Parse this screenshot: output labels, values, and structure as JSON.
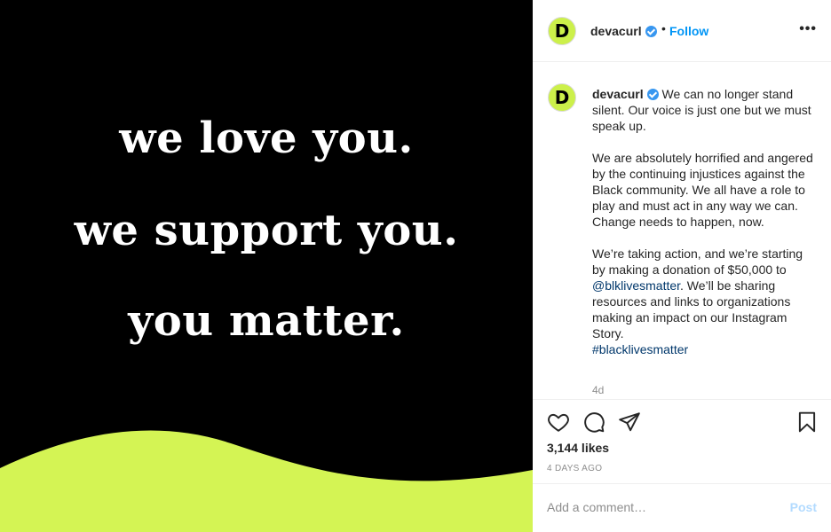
{
  "image": {
    "lines": [
      "we love you.",
      "we support you.",
      "you matter."
    ],
    "background_color": "#000000",
    "accent_color": "#d4f454"
  },
  "header": {
    "avatar_letter": "D",
    "username": "devacurl",
    "separator": "•",
    "follow_label": "Follow",
    "more_label": "•••"
  },
  "caption": {
    "avatar_letter": "D",
    "username": "devacurl",
    "first_line": "We can no longer stand silent. Our voice is just one but we must speak up.",
    "paragraph_2": "We are absolutely horrified and angered by the continuing injustices against the Black community. We all have a role to play and must act in any way we can. Change needs to happen, now.",
    "paragraph_3_before": "We’re taking action, and we’re starting by making a donation of $50,000 to ",
    "mention": "@blklivesmatter",
    "paragraph_3_after": ". We’ll be sharing resources and links to organizations making an impact on our Instagram Story.",
    "hashtag": "#blacklivesmatter",
    "age": "4d"
  },
  "actions": {
    "icons": [
      "heart-icon",
      "comment-icon",
      "share-icon",
      "bookmark-icon"
    ],
    "likes": "3,144 likes",
    "timestamp": "4 DAYS AGO"
  },
  "comment_box": {
    "placeholder": "Add a comment…",
    "post_label": "Post"
  },
  "colors": {
    "follow": "#0095f6",
    "verified": "#3897f0",
    "link": "#00376b",
    "post_disabled": "#b3dbff",
    "avatar_bg": "#ccf04a"
  }
}
